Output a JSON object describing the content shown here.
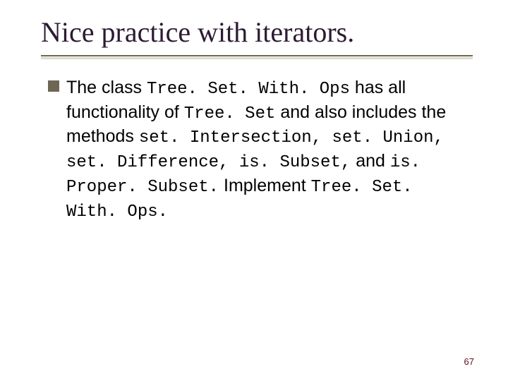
{
  "title": "Nice practice with iterators.",
  "bullet": {
    "t1": "The class ",
    "c1": "Tree. Set. With. Ops",
    "t2": " has all functionality of ",
    "c2": "Tree. Set",
    "t3": " and also includes the methods ",
    "c3": "set. Intersection, set. Union, set. Difference, is. Subset,",
    "t4": " and ",
    "c4": "is. Proper. Subset.",
    "t5": " Implement ",
    "c5": "Tree. Set. With. Ops.",
    "t6": ""
  },
  "page_number": "67"
}
